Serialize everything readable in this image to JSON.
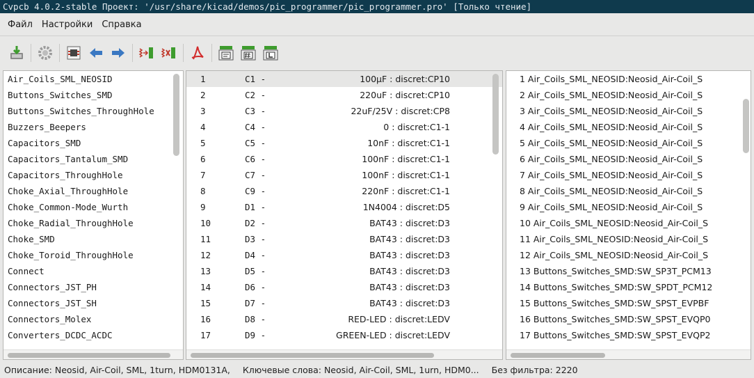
{
  "window": {
    "title": "Cvpcb 4.0.2-stable  Проект: '/usr/share/kicad/demos/pic_programmer/pic_programmer.pro' [Только чтение]"
  },
  "menu": [
    "Файл",
    "Настройки",
    "Справка"
  ],
  "toolbar": [
    {
      "icon": "save-icon",
      "group": 1
    },
    {
      "icon": "settings-icon",
      "group": 2
    },
    {
      "icon": "footprint-viewer-icon",
      "group": 3
    },
    {
      "icon": "arrow-left-icon",
      "group": 3
    },
    {
      "icon": "arrow-right-icon",
      "group": 3
    },
    {
      "icon": "auto-associate-icon",
      "group": 4
    },
    {
      "icon": "delete-associations-icon",
      "group": 4
    },
    {
      "icon": "pdf-icon",
      "group": 4
    },
    {
      "icon": "filter-keywords-icon",
      "group": 5
    },
    {
      "icon": "filter-pincount-icon",
      "group": 5
    },
    {
      "icon": "filter-library-icon",
      "group": 5
    }
  ],
  "libraries": [
    "Air_Coils_SML_NEOSID",
    "Buttons_Switches_SMD",
    "Buttons_Switches_ThroughHole",
    "Buzzers_Beepers",
    "Capacitors_SMD",
    "Capacitors_Tantalum_SMD",
    "Capacitors_ThroughHole",
    "Choke_Axial_ThroughHole",
    "Choke_Common-Mode_Wurth",
    "Choke_Radial_ThroughHole",
    "Choke_SMD",
    "Choke_Toroid_ThroughHole",
    "Connect",
    "Connectors_JST_PH",
    "Connectors_JST_SH",
    "Connectors_Molex",
    "Converters_DCDC_ACDC"
  ],
  "components": [
    {
      "num": "1",
      "ref": "C1 -",
      "value": "100µF : discret:CP10",
      "selected": true
    },
    {
      "num": "2",
      "ref": "C2 -",
      "value": "220uF : discret:CP10"
    },
    {
      "num": "3",
      "ref": "C3 -",
      "value": "22uF/25V : discret:CP8"
    },
    {
      "num": "4",
      "ref": "C4 -",
      "value": "0 : discret:C1-1"
    },
    {
      "num": "5",
      "ref": "C5 -",
      "value": "10nF : discret:C1-1"
    },
    {
      "num": "6",
      "ref": "C6 -",
      "value": "100nF : discret:C1-1"
    },
    {
      "num": "7",
      "ref": "C7 -",
      "value": "100nF : discret:C1-1"
    },
    {
      "num": "8",
      "ref": "C9 -",
      "value": "220nF : discret:C1-1"
    },
    {
      "num": "9",
      "ref": "D1 -",
      "value": "1N4004 : discret:D5"
    },
    {
      "num": "10",
      "ref": "D2 -",
      "value": "BAT43 : discret:D3"
    },
    {
      "num": "11",
      "ref": "D3 -",
      "value": "BAT43 : discret:D3"
    },
    {
      "num": "12",
      "ref": "D4 -",
      "value": "BAT43 : discret:D3"
    },
    {
      "num": "13",
      "ref": "D5 -",
      "value": "BAT43 : discret:D3"
    },
    {
      "num": "14",
      "ref": "D6 -",
      "value": "BAT43 : discret:D3"
    },
    {
      "num": "15",
      "ref": "D7 -",
      "value": "BAT43 : discret:D3"
    },
    {
      "num": "16",
      "ref": "D8 -",
      "value": "RED-LED : discret:LEDV"
    },
    {
      "num": "17",
      "ref": "D9 -",
      "value": "GREEN-LED : discret:LEDV"
    }
  ],
  "footprints": [
    "1 Air_Coils_SML_NEOSID:Neosid_Air-Coil_S",
    "2 Air_Coils_SML_NEOSID:Neosid_Air-Coil_S",
    "3 Air_Coils_SML_NEOSID:Neosid_Air-Coil_S",
    "4 Air_Coils_SML_NEOSID:Neosid_Air-Coil_S",
    "5 Air_Coils_SML_NEOSID:Neosid_Air-Coil_S",
    "6 Air_Coils_SML_NEOSID:Neosid_Air-Coil_S",
    "7 Air_Coils_SML_NEOSID:Neosid_Air-Coil_S",
    "8 Air_Coils_SML_NEOSID:Neosid_Air-Coil_S",
    "9 Air_Coils_SML_NEOSID:Neosid_Air-Coil_S",
    "10 Air_Coils_SML_NEOSID:Neosid_Air-Coil_S",
    "11 Air_Coils_SML_NEOSID:Neosid_Air-Coil_S",
    "12 Air_Coils_SML_NEOSID:Neosid_Air-Coil_S",
    "13 Buttons_Switches_SMD:SW_SP3T_PCM13",
    "14 Buttons_Switches_SMD:SW_SPDT_PCM12",
    "15 Buttons_Switches_SMD:SW_SPST_EVPBF",
    "16 Buttons_Switches_SMD:SW_SPST_EVQP0",
    "17 Buttons_Switches_SMD:SW_SPST_EVQP2"
  ],
  "status": {
    "description": "Описание: Neosid, Air-Coil, SML, 1turn, HDM0131A,",
    "keywords": "Ключевые слова: Neosid, Air-Coil, SML, 1urn, HDM0...",
    "filter": "Без фильтра: 2220"
  }
}
